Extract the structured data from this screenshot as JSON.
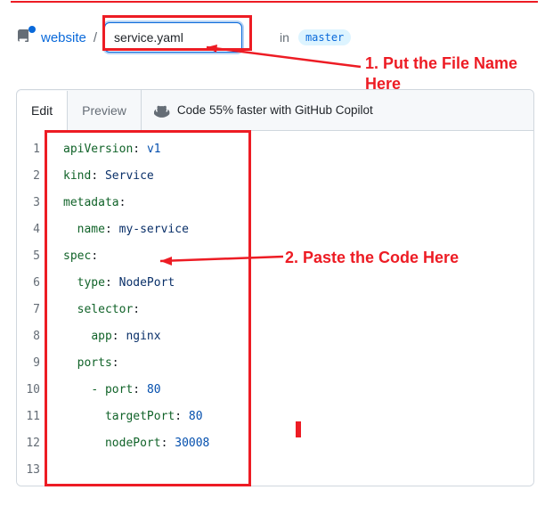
{
  "breadcrumb": {
    "repo": "website",
    "separator": "/"
  },
  "filename": {
    "value": "service.yaml",
    "placeholder": "Name your file..."
  },
  "branch": {
    "in_label": "in",
    "name": "master"
  },
  "tabs": {
    "edit": "Edit",
    "preview": "Preview"
  },
  "copilot": {
    "text": "Code 55% faster with GitHub Copilot"
  },
  "annotations": {
    "step1": "1. Put the File Name Here",
    "step2": "2. Paste the Code Here"
  },
  "code_lines": [
    {
      "n": 1,
      "key": "apiVersion",
      "colon": ": ",
      "val": "v1",
      "indent": 0
    },
    {
      "n": 2,
      "key": "kind",
      "colon": ": ",
      "val": "Service",
      "indent": 0,
      "valClass": "yaml-str"
    },
    {
      "n": 3,
      "key": "metadata",
      "colon": ":",
      "val": "",
      "indent": 0
    },
    {
      "n": 4,
      "key": "name",
      "colon": ": ",
      "val": "my-service",
      "indent": 2,
      "valClass": "yaml-str"
    },
    {
      "n": 5,
      "key": "spec",
      "colon": ":",
      "val": "",
      "indent": 0
    },
    {
      "n": 6,
      "key": "type",
      "colon": ": ",
      "val": "NodePort",
      "indent": 2,
      "valClass": "yaml-str"
    },
    {
      "n": 7,
      "key": "selector",
      "colon": ":",
      "val": "",
      "indent": 2
    },
    {
      "n": 8,
      "key": "app",
      "colon": ": ",
      "val": "nginx",
      "indent": 4,
      "valClass": "yaml-str"
    },
    {
      "n": 9,
      "key": "ports",
      "colon": ":",
      "val": "",
      "indent": 2
    },
    {
      "n": 10,
      "dash": "- ",
      "key": "port",
      "colon": ": ",
      "val": "80",
      "indent": 4
    },
    {
      "n": 11,
      "key": "targetPort",
      "colon": ": ",
      "val": "80",
      "indent": 6
    },
    {
      "n": 12,
      "key": "nodePort",
      "colon": ": ",
      "val": "30008",
      "indent": 6
    },
    {
      "n": 13,
      "key": "",
      "colon": "",
      "val": "",
      "indent": 0
    }
  ]
}
